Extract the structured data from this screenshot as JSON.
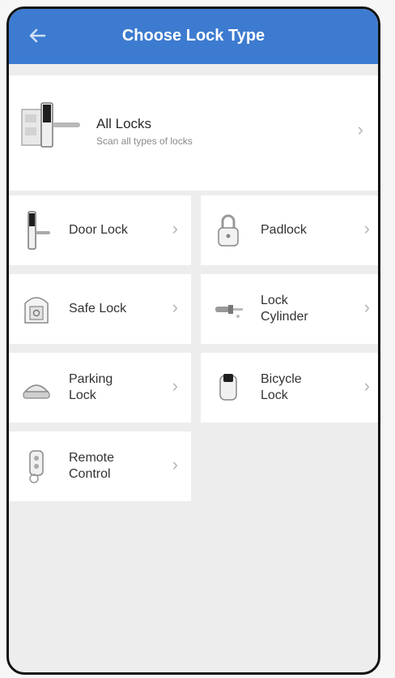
{
  "header": {
    "title": "Choose Lock Type"
  },
  "all_locks": {
    "title": "All Locks",
    "subtitle": "Scan all types of locks"
  },
  "tiles": [
    {
      "label": "Door Lock",
      "icon": "door-lock-icon"
    },
    {
      "label": "Padlock",
      "icon": "padlock-icon"
    },
    {
      "label": "Safe Lock",
      "icon": "safe-lock-icon"
    },
    {
      "label": "Lock\nCylinder",
      "icon": "lock-cylinder-icon"
    },
    {
      "label": "Parking\nLock",
      "icon": "parking-lock-icon"
    },
    {
      "label": "Bicycle\nLock",
      "icon": "bicycle-lock-icon"
    },
    {
      "label": "Remote\nControl",
      "icon": "remote-control-icon"
    }
  ],
  "colors": {
    "header": "#3d7bd0",
    "background": "#ededed",
    "card": "#ffffff"
  }
}
